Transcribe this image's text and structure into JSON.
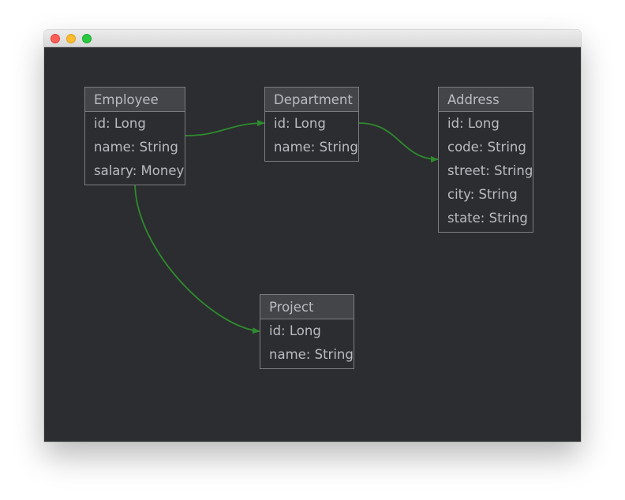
{
  "colors": {
    "canvas_background": "#2c2d30",
    "entity_header_background": "#434549",
    "entity_border": "#7a7c80",
    "text": "#b9bcc2",
    "relationship_edge": "#2e8b2e"
  },
  "entities": {
    "employee": {
      "name": "Employee",
      "fields": [
        "id: Long",
        "name: String",
        "salary: Money"
      ]
    },
    "department": {
      "name": "Department",
      "fields": [
        "id: Long",
        "name: String"
      ]
    },
    "address": {
      "name": "Address",
      "fields": [
        "id: Long",
        "code: String",
        "street: String",
        "city: String",
        "state: String"
      ]
    },
    "project": {
      "name": "Project",
      "fields": [
        "id: Long",
        "name: String"
      ]
    }
  },
  "relationships": [
    {
      "from": "Employee",
      "to": "Department"
    },
    {
      "from": "Department",
      "to": "Address"
    },
    {
      "from": "Employee",
      "to": "Project"
    }
  ]
}
